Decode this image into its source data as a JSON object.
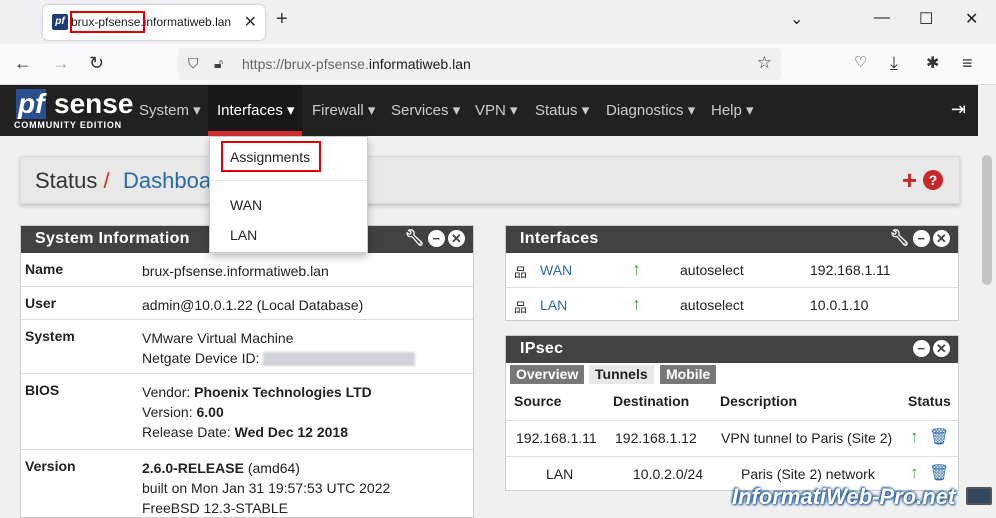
{
  "browser": {
    "tab_title": "brux-pfsense.informatiweb.lan",
    "url_prefix": "https://brux-pfsense.",
    "url_domain": "informatiweb.lan"
  },
  "pfsense": {
    "logo_pf": "pf",
    "logo_sense": "sense",
    "logo_edition": "COMMUNITY EDITION",
    "menu": [
      "System",
      "Interfaces",
      "Firewall",
      "Services",
      "VPN",
      "Status",
      "Diagnostics",
      "Help"
    ],
    "active_menu": "Interfaces"
  },
  "dropdown": {
    "items": [
      "Assignments",
      "WAN",
      "LAN"
    ]
  },
  "breadcrumb": {
    "root": "Status",
    "separator": "/",
    "page": "Dashboard"
  },
  "system_info": {
    "title": "System Information",
    "rows": [
      {
        "key": "Name",
        "lines": [
          "brux-pfsense.informatiweb.lan"
        ]
      },
      {
        "key": "User",
        "lines": [
          "admin@10.0.1.22 (Local Database)"
        ]
      },
      {
        "key": "System",
        "lines": [
          "VMware Virtual Machine",
          "Netgate Device ID:"
        ]
      },
      {
        "key": "BIOS",
        "vendor_label": "Vendor: ",
        "vendor": "Phoenix Technologies LTD",
        "version_label": "Version: ",
        "version": "6.00",
        "release_label": "Release Date: ",
        "release": "Wed Dec 12 2018"
      },
      {
        "key": "Version",
        "release_name": "2.6.0-RELEASE",
        "arch": " (amd64)",
        "built": "built on Mon Jan 31 19:57:53 UTC 2022",
        "os": "FreeBSD 12.3-STABLE"
      }
    ]
  },
  "interfaces": {
    "title": "Interfaces",
    "rows": [
      {
        "name": "WAN",
        "media": "autoselect",
        "ip": "192.168.1.11"
      },
      {
        "name": "LAN",
        "media": "autoselect",
        "ip": "10.0.1.10"
      }
    ]
  },
  "ipsec": {
    "title": "IPsec",
    "tabs": [
      "Overview",
      "Tunnels",
      "Mobile"
    ],
    "active_tab": "Tunnels",
    "headers": [
      "Source",
      "Destination",
      "Description",
      "Status"
    ],
    "rows": [
      {
        "source": "192.168.1.11",
        "destination": "192.168.1.12",
        "description": "VPN tunnel to Paris (Site 2)"
      },
      {
        "source": "LAN",
        "destination": "10.0.2.0/24",
        "description": "Paris (Site 2) network"
      }
    ]
  },
  "watermark": "InformatiWeb-Pro.net"
}
